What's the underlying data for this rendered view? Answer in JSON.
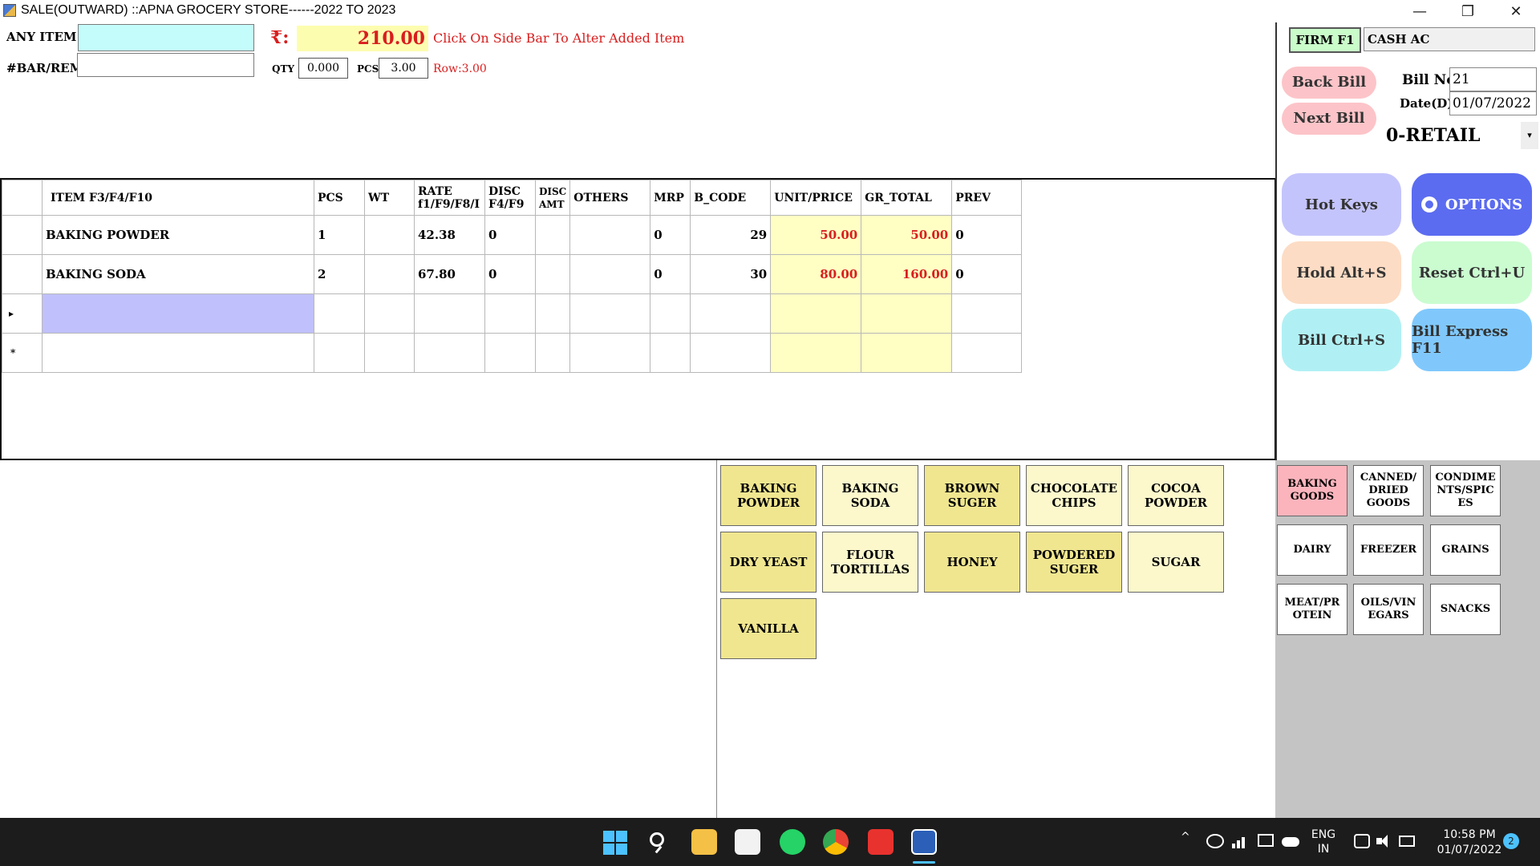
{
  "window": {
    "title": "SALE(OUTWARD) ::APNA GROCERY STORE------2022 TO 2023",
    "minimize": "—",
    "restore": "❐",
    "close": "✕"
  },
  "top": {
    "any_item_label": "ANY ITEM",
    "bar_label": "#BAR/REM",
    "currency": "₹:",
    "amount": "210.00",
    "hint": "Click On Side Bar To Alter Added Item",
    "qty_label": "QTY",
    "qty_value": "0.000",
    "pcs_label": "PCS",
    "pcs_value": "3.00",
    "row_text": "Row:3.00"
  },
  "grid": {
    "headers": [
      "ITEM F3/F4/F10",
      "PCS",
      "WT",
      "RATE f1/F9/F8/I",
      "DISC F4/F9",
      "DISC AMT",
      "OTHERS",
      "MRP",
      "B_CODE",
      "UNIT/PRICE",
      "GR_TOTAL",
      "PREV"
    ],
    "rows": [
      {
        "item": "BAKING POWDER",
        "pcs": "1",
        "wt": "",
        "rate": "42.38",
        "disc": "0",
        "disc_amt": "",
        "others": "",
        "mrp": "0",
        "b_code": "29",
        "unit_price": "50.00",
        "gr_total": "50.00",
        "prev": "0"
      },
      {
        "item": "BAKING SODA",
        "pcs": "2",
        "wt": "",
        "rate": "67.80",
        "disc": "0",
        "disc_amt": "",
        "others": "",
        "mrp": "0",
        "b_code": "30",
        "unit_price": "80.00",
        "gr_total": "160.00",
        "prev": "0"
      }
    ],
    "current_marker": "▸",
    "new_marker": "*"
  },
  "side": {
    "firm": "FIRM F1",
    "account": "CASH AC",
    "back_bill": "Back Bill",
    "next_bill": "Next Bill",
    "bill_no_label": "Bill No",
    "bill_no": "21",
    "date_label": "Date(D)",
    "date": "01/07/2022",
    "price_type": "0-RETAIL",
    "dropdown": "▾",
    "hot_keys": "Hot Keys",
    "options": "OPTIONS",
    "hold": "Hold Alt+S",
    "reset": "Reset Ctrl+U",
    "bill": "Bill Ctrl+S",
    "bill_express": "Bill Express F11"
  },
  "items": [
    "BAKING POWDER",
    "BAKING SODA",
    "BROWN SUGER",
    "CHOCOLATE CHIPS",
    "COCOA POWDER",
    "DRY YEAST",
    "FLOUR TORTILLAS",
    "HONEY",
    "POWDERED SUGER",
    "SUGAR",
    "VANILLA"
  ],
  "categories": [
    "BAKING GOODS",
    "CANNED/ DRIED GOODS",
    "CONDIME NTS/SPIC ES",
    "DAIRY",
    "FREEZER",
    "GRAINS",
    "MEAT/PR OTEIN",
    "OILS/VIN EGARS",
    "SNACKS"
  ],
  "taskbar": {
    "lang": "ENG",
    "region": "IN",
    "time": "10:58 PM",
    "date": "01/07/2022",
    "notifications": "2"
  },
  "colors": {
    "accent_red": "#d81e1e",
    "amount_bg": "#fdfdb0",
    "cell_yellow": "#ffffc4",
    "selected_cell": "#c0c0fc",
    "options_button": "#5b6cf0"
  }
}
